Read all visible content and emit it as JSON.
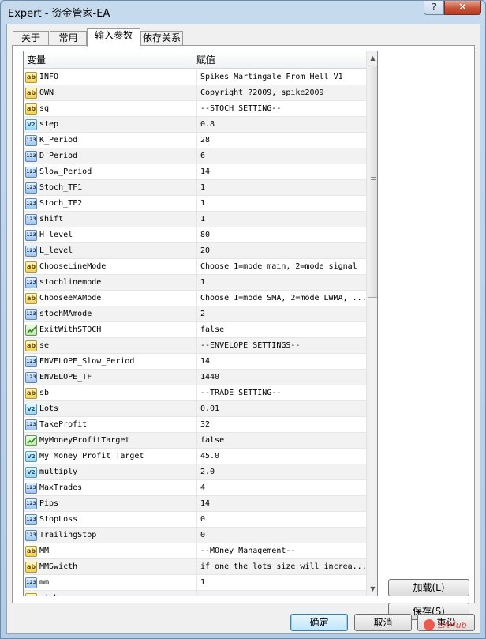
{
  "window": {
    "title": "Expert - 资金管家-EA",
    "help_label": "?",
    "close_label": "✕"
  },
  "tabs": [
    {
      "label": "关于"
    },
    {
      "label": "常用"
    },
    {
      "label": "输入参数",
      "active": true
    },
    {
      "label": "依存关系"
    }
  ],
  "grid": {
    "headers": {
      "variable": "变量",
      "value": "赋值"
    },
    "rows": [
      {
        "type": "string",
        "icon": "ab",
        "name": "INFO",
        "value": "Spikes_Martingale_From_Hell_V1"
      },
      {
        "type": "string",
        "icon": "ab",
        "name": "OWN",
        "value": "Copyright ?2009, spike2009"
      },
      {
        "type": "string",
        "icon": "ab",
        "name": "sq",
        "value": "--STOCH SETTING--"
      },
      {
        "type": "double",
        "icon": "V2",
        "name": "step",
        "value": "0.8"
      },
      {
        "type": "int",
        "icon": "123",
        "name": "K_Period",
        "value": "28"
      },
      {
        "type": "int",
        "icon": "123",
        "name": "D_Period",
        "value": "6"
      },
      {
        "type": "int",
        "icon": "123",
        "name": "Slow_Period",
        "value": "14"
      },
      {
        "type": "int",
        "icon": "123",
        "name": "Stoch_TF1",
        "value": "1"
      },
      {
        "type": "int",
        "icon": "123",
        "name": "Stoch_TF2",
        "value": "1"
      },
      {
        "type": "int",
        "icon": "123",
        "name": "shift",
        "value": "1"
      },
      {
        "type": "int",
        "icon": "123",
        "name": "H_level",
        "value": "80"
      },
      {
        "type": "int",
        "icon": "123",
        "name": "L_level",
        "value": "20"
      },
      {
        "type": "string",
        "icon": "ab",
        "name": "ChooseLineMode",
        "value": "Choose 1=mode main, 2=mode signal"
      },
      {
        "type": "int",
        "icon": "123",
        "name": "stochlinemode",
        "value": "1"
      },
      {
        "type": "string",
        "icon": "ab",
        "name": "ChooseeMAMode",
        "value": "Choose 1=mode SMA, 2=mode LWMA, ..."
      },
      {
        "type": "int",
        "icon": "123",
        "name": "stochMAmode",
        "value": "2"
      },
      {
        "type": "bool",
        "icon": "check",
        "name": "ExitWithSTOCH",
        "value": "false"
      },
      {
        "type": "string",
        "icon": "ab",
        "name": "se",
        "value": "--ENVELOPE SETTINGS--"
      },
      {
        "type": "int",
        "icon": "123",
        "name": "ENVELOPE_Slow_Period",
        "value": "14"
      },
      {
        "type": "int",
        "icon": "123",
        "name": "ENVELOPE_TF",
        "value": "1440"
      },
      {
        "type": "string",
        "icon": "ab",
        "name": "sb",
        "value": "--TRADE SETTING--"
      },
      {
        "type": "double",
        "icon": "V2",
        "name": "Lots",
        "value": "0.01"
      },
      {
        "type": "int",
        "icon": "123",
        "name": "TakeProfit",
        "value": "32"
      },
      {
        "type": "bool",
        "icon": "check",
        "name": "MyMoneyProfitTarget",
        "value": "false"
      },
      {
        "type": "double",
        "icon": "V2",
        "name": "My_Money_Profit_Target",
        "value": "45.0"
      },
      {
        "type": "double",
        "icon": "V2",
        "name": "multiply",
        "value": "2.0"
      },
      {
        "type": "int",
        "icon": "123",
        "name": "MaxTrades",
        "value": "4"
      },
      {
        "type": "int",
        "icon": "123",
        "name": "Pips",
        "value": "14"
      },
      {
        "type": "int",
        "icon": "123",
        "name": "StopLoss",
        "value": "0"
      },
      {
        "type": "int",
        "icon": "123",
        "name": "TrailingStop",
        "value": "0"
      },
      {
        "type": "string",
        "icon": "ab",
        "name": "MM",
        "value": "--MOney Management--"
      },
      {
        "type": "string",
        "icon": "ab",
        "name": "MMSwicth",
        "value": "if one the lots size will increa..."
      },
      {
        "type": "int",
        "icon": "123",
        "name": "mm",
        "value": "1"
      },
      {
        "type": "string",
        "icon": "ab",
        "name": "risk",
        "value": "..."
      }
    ]
  },
  "side_buttons": {
    "load": "加载(L)",
    "save": "保存(S)"
  },
  "dialog_buttons": {
    "ok": "确定",
    "cancel": "取消",
    "reset": "重设"
  },
  "watermark": {
    "text": "EAHub"
  }
}
